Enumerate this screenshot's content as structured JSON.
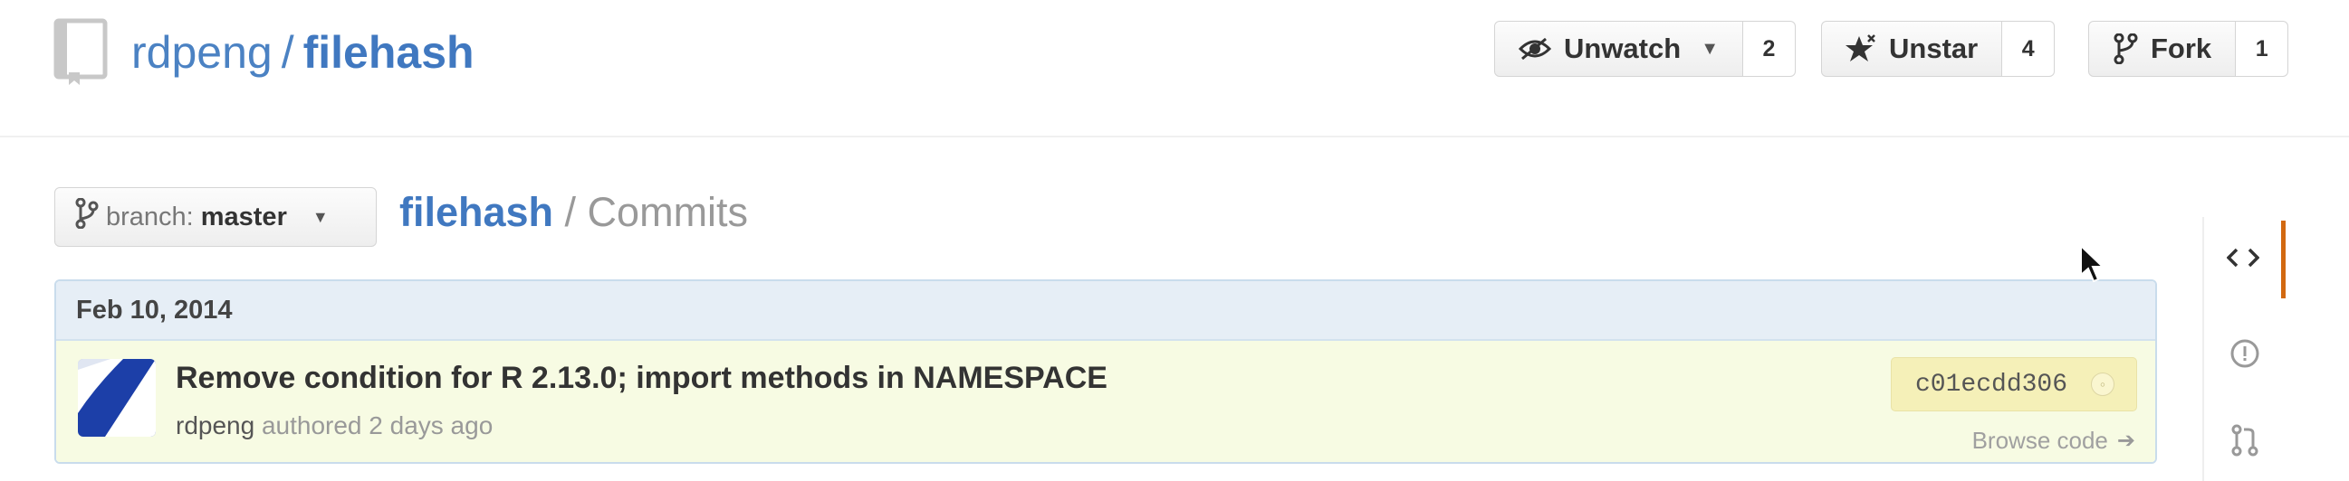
{
  "header": {
    "owner": "rdpeng",
    "separator": "/",
    "repo": "filehash",
    "actions": [
      {
        "label": "Unwatch",
        "count": "2",
        "icon": "eye-icon",
        "has_dropdown": true
      },
      {
        "label": "Unstar",
        "count": "4",
        "icon": "star-icon"
      },
      {
        "label": "Fork",
        "count": "1",
        "icon": "fork-icon"
      }
    ]
  },
  "branch": {
    "prefix": "branch:",
    "name": "master"
  },
  "breadcrumb": {
    "repo": "filehash",
    "rest": " / Commits"
  },
  "commits": {
    "date": "Feb 10, 2014",
    "items": [
      {
        "message": "Remove condition for R 2.13.0; import methods in NAMESPACE",
        "author": "rdpeng",
        "meta": " authored 2 days ago",
        "sha": "c01ecdd306",
        "browse": "Browse code"
      }
    ]
  },
  "sidenav": [
    "code-icon",
    "issues-icon",
    "pull-request-icon"
  ],
  "colors": {
    "link": "#4078c0",
    "commit_bg": "#f7fbe3",
    "sha_bg": "#f5f0b8",
    "active_nav": "#d26911"
  }
}
